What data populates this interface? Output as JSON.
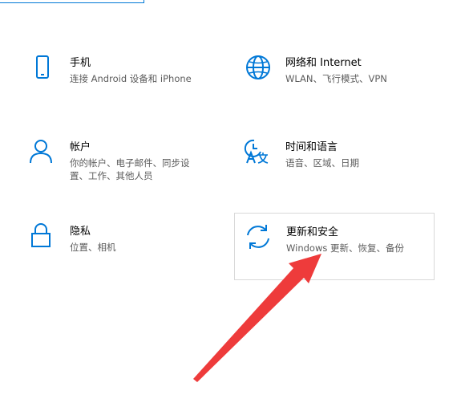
{
  "accent_color": "#0078d7",
  "annotation_color": "#ee3b3b",
  "tiles": [
    {
      "id": "phone",
      "icon": "phone-icon",
      "title": "手机",
      "desc": [
        "连接 Android 设备和 iPhone"
      ]
    },
    {
      "id": "network",
      "icon": "globe-icon",
      "title": "网络和 Internet",
      "desc": [
        "WLAN、飞行模式、VPN"
      ]
    },
    {
      "id": "accounts",
      "icon": "person-icon",
      "title": "帐户",
      "desc": [
        "你的帐户、电子邮件、同步设",
        "置、工作、其他人员"
      ]
    },
    {
      "id": "time-language",
      "icon": "time-language-icon",
      "title": "时间和语言",
      "desc": [
        "语音、区域、日期"
      ]
    },
    {
      "id": "privacy",
      "icon": "lock-icon",
      "title": "隐私",
      "desc": [
        "位置、相机"
      ]
    },
    {
      "id": "update-security",
      "icon": "sync-icon",
      "title": "更新和安全",
      "desc": [
        "Windows 更新、恢复、备份"
      ]
    }
  ]
}
